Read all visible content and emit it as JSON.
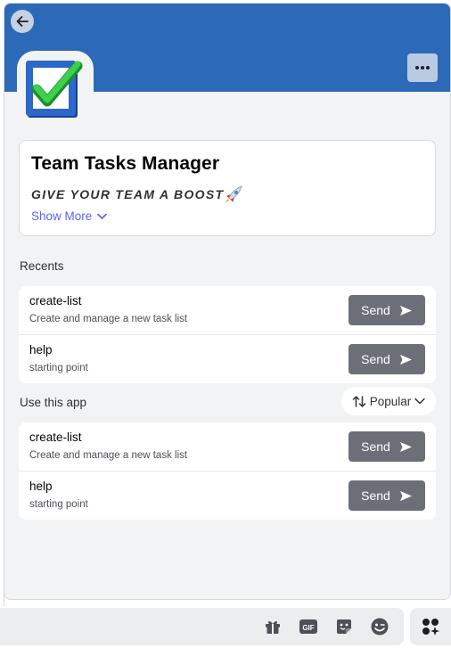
{
  "app": {
    "name": "Team Tasks Manager",
    "tagline": "GIVE YOUR TEAM A BOOST",
    "show_more_label": "Show More"
  },
  "recents": {
    "title": "Recents",
    "items": [
      {
        "name": "create-list",
        "description": "Create and manage a new task list",
        "button": "Send"
      },
      {
        "name": "help",
        "description": "starting point",
        "button": "Send"
      }
    ]
  },
  "use_app": {
    "title": "Use this app",
    "sort_label": "Popular",
    "items": [
      {
        "name": "create-list",
        "description": "Create and manage a new task list",
        "button": "Send"
      },
      {
        "name": "help",
        "description": "starting point",
        "button": "Send"
      }
    ]
  },
  "composer": {
    "gif_label": "GIF",
    "icons": [
      "gift-icon",
      "gif-icon",
      "sticker-icon",
      "emoji-icon",
      "apps-icon"
    ]
  },
  "colors": {
    "banner": "#2c6ab7",
    "panel": "#f2f3f5",
    "send_button": "#6d6f78",
    "link": "#5865f2",
    "checkmark": "#22b14c"
  }
}
